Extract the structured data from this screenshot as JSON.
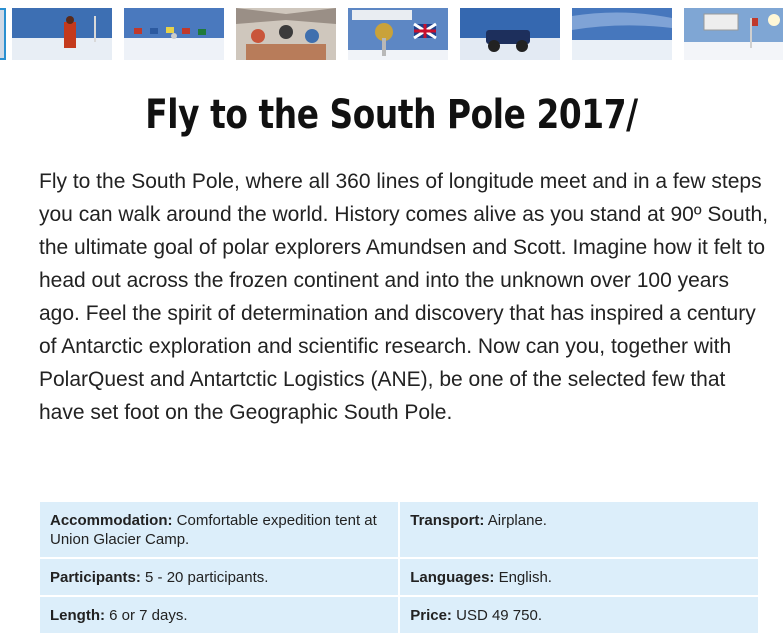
{
  "thumbnails": [
    {
      "name": "thumb-person-on-ice",
      "sky": "#3d6fb3",
      "ground": "#e8eef5"
    },
    {
      "name": "thumb-flags-ceremonial-pole",
      "sky": "#4a79be",
      "ground": "#eef2f8"
    },
    {
      "name": "thumb-tent-interior-group",
      "sky": "#9a8f86",
      "ground": "#cfc7bd"
    },
    {
      "name": "thumb-south-pole-marker",
      "sky": "#5d87c4",
      "ground": "#f0f3f8"
    },
    {
      "name": "thumb-expedition-vehicle",
      "sky": "#3568b0",
      "ground": "#e3eaf3"
    },
    {
      "name": "thumb-snow-landscape",
      "sky": "#4677bd",
      "ground": "#eaf0f7"
    },
    {
      "name": "thumb-pole-sign",
      "sky": "#7fa6d4",
      "ground": "#f3f5f9"
    }
  ],
  "title": "Fly to the South Pole 2017/",
  "intro": "Fly to the South Pole, where all 360 lines of longitude meet and in a few steps you can walk around the world. History comes alive as you stand at 90º South, the ultimate goal of polar explorers Amundsen and Scott. Imagine how it felt to head out across the frozen continent and into the unknown over 100 years ago. Feel the spirit of determination and discovery that has inspired a century of Antarctic exploration and scientific research. Now can you, together with PolarQuest and Antartctic Logistics (ANE), be one of the selected few that have set foot on the Geographic South Pole.",
  "facts": {
    "accommodation": {
      "label": "Accommodation:",
      "value": " Comfortable expedition tent at Union Glacier Camp."
    },
    "transport": {
      "label": "Transport:",
      "value": " Airplane."
    },
    "participants": {
      "label": "Participants:",
      "value": " 5 - 20 participants."
    },
    "languages": {
      "label": "Languages:",
      "value": " English."
    },
    "length": {
      "label": "Length:",
      "value": " 6 or 7 days."
    },
    "price": {
      "label": "Price:",
      "value": " USD 49 750."
    }
  },
  "colors": {
    "table_bg": "#dceefa",
    "thumb_active": "#2a8fd0"
  }
}
